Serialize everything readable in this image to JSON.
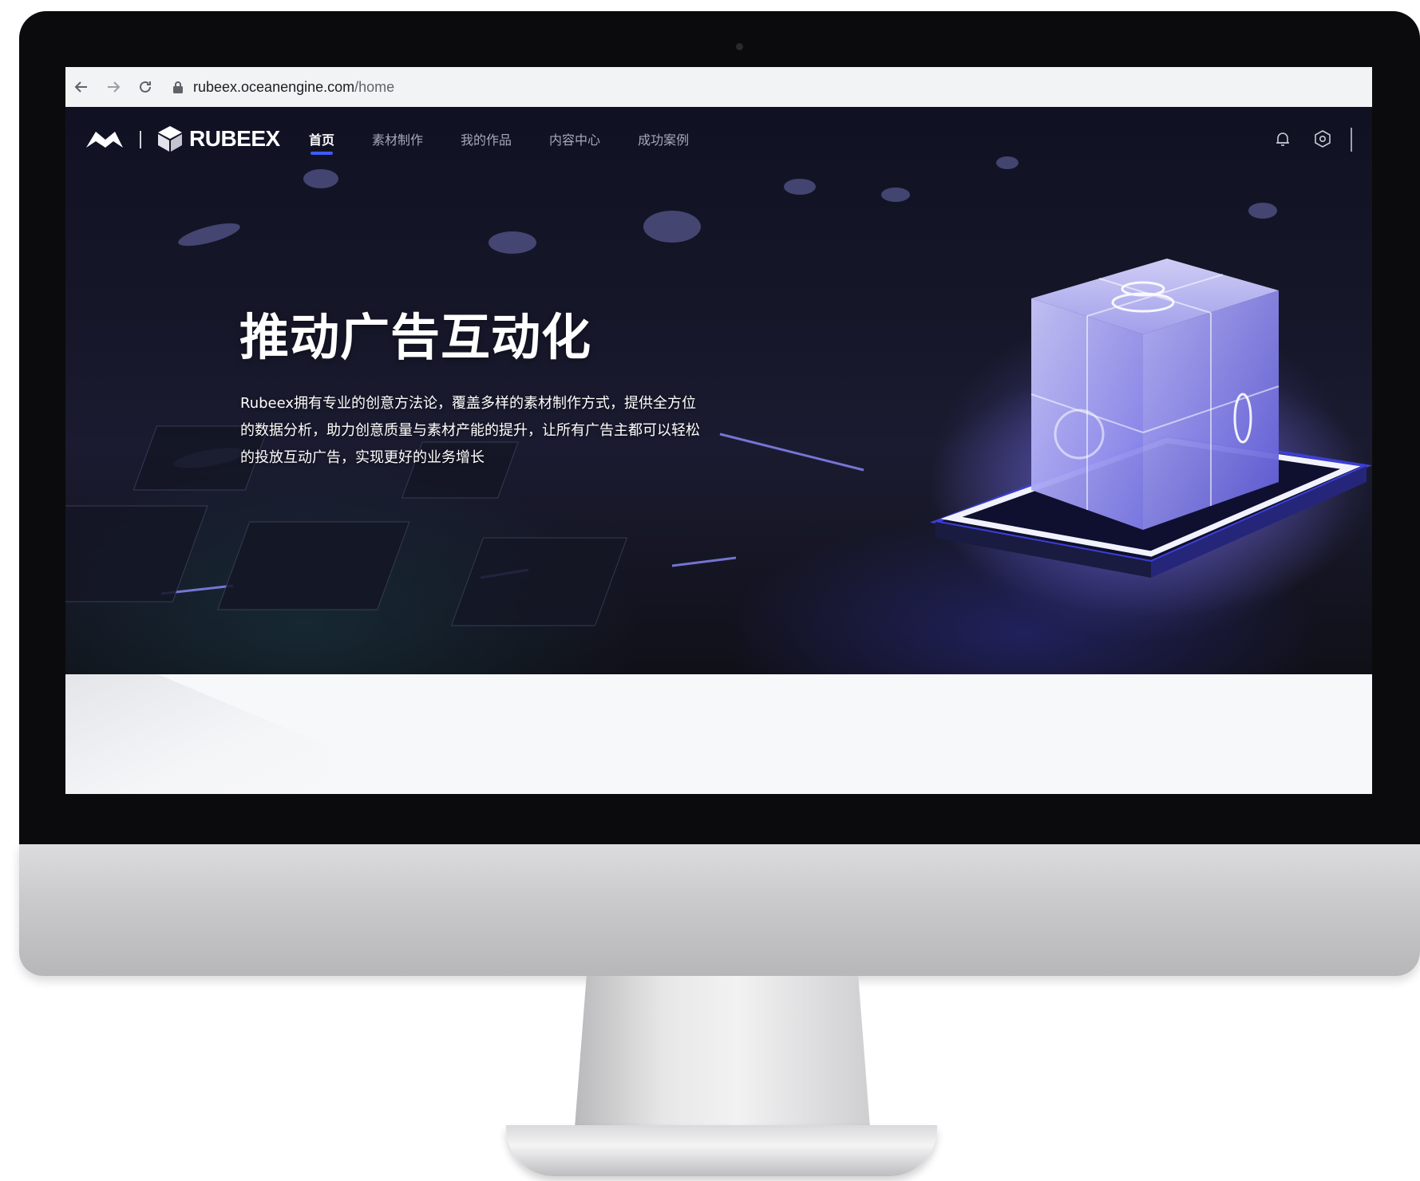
{
  "browser": {
    "url_host": "rubeex.oceanengine.com",
    "url_path": "/home"
  },
  "site": {
    "brand_name": "RUBEEX",
    "nav": [
      {
        "label": "首页",
        "active": true
      },
      {
        "label": "素材制作",
        "active": false
      },
      {
        "label": "我的作品",
        "active": false
      },
      {
        "label": "内容中心",
        "active": false
      },
      {
        "label": "成功案例",
        "active": false
      }
    ],
    "icons": [
      "bell-icon",
      "settings-icon"
    ]
  },
  "hero": {
    "title": "推动广告互动化",
    "description_lines": [
      "Rubeex拥有专业的创意方法论，覆盖多样的素材制作方式，提供全方位",
      "的数据分析，助力创意质量与素材产能的提升，让所有广告主都可以轻松",
      "的投放互动广告，实现更好的业务增长"
    ]
  },
  "colors": {
    "accent": "#3d5cff",
    "hero_bg": "#151628",
    "nav_text": "#a7a9b8"
  }
}
